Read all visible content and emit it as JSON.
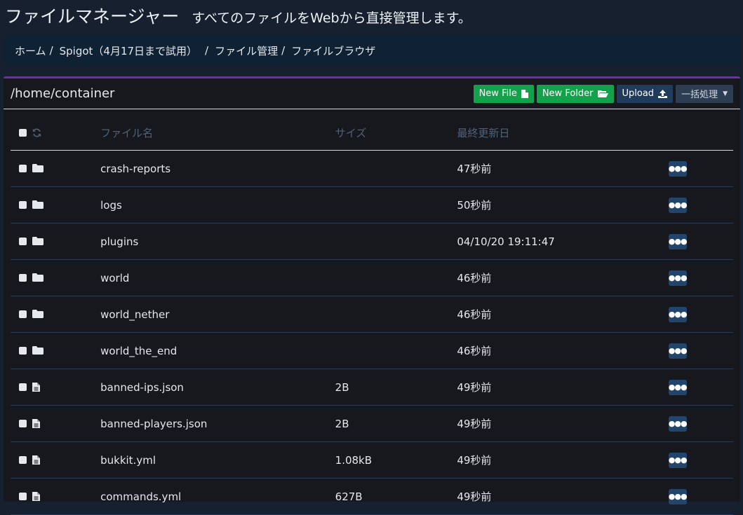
{
  "header": {
    "title": "ファイルマネージャー",
    "subtitle": "すべてのファイルをWebから直接管理します。"
  },
  "breadcrumb": [
    {
      "label": "ホーム"
    },
    {
      "label": "Spigot（4月17日まで試用）"
    },
    {
      "label": "ファイル管理"
    },
    {
      "label": "ファイルブラウザ"
    }
  ],
  "panel": {
    "path": "/home/container",
    "accent_color": "#7d22c4"
  },
  "toolbar": {
    "new_file_label": "New File",
    "new_folder_label": "New Folder",
    "upload_label": "Upload",
    "bulk_label": "一括処理"
  },
  "table": {
    "columns": {
      "name": "ファイル名",
      "size": "サイズ",
      "modified": "最終更新日"
    },
    "rows": [
      {
        "type": "folder",
        "name": "crash-reports",
        "size": "",
        "modified": "47秒前"
      },
      {
        "type": "folder",
        "name": "logs",
        "size": "",
        "modified": "50秒前"
      },
      {
        "type": "folder",
        "name": "plugins",
        "size": "",
        "modified": "04/10/20 19:11:47"
      },
      {
        "type": "folder",
        "name": "world",
        "size": "",
        "modified": "46秒前"
      },
      {
        "type": "folder",
        "name": "world_nether",
        "size": "",
        "modified": "46秒前"
      },
      {
        "type": "folder",
        "name": "world_the_end",
        "size": "",
        "modified": "46秒前"
      },
      {
        "type": "file",
        "name": "banned-ips.json",
        "size": "2B",
        "modified": "49秒前"
      },
      {
        "type": "file",
        "name": "banned-players.json",
        "size": "2B",
        "modified": "49秒前"
      },
      {
        "type": "file",
        "name": "bukkit.yml",
        "size": "1.08kB",
        "modified": "49秒前"
      },
      {
        "type": "file",
        "name": "commands.yml",
        "size": "627B",
        "modified": "49秒前"
      }
    ]
  }
}
